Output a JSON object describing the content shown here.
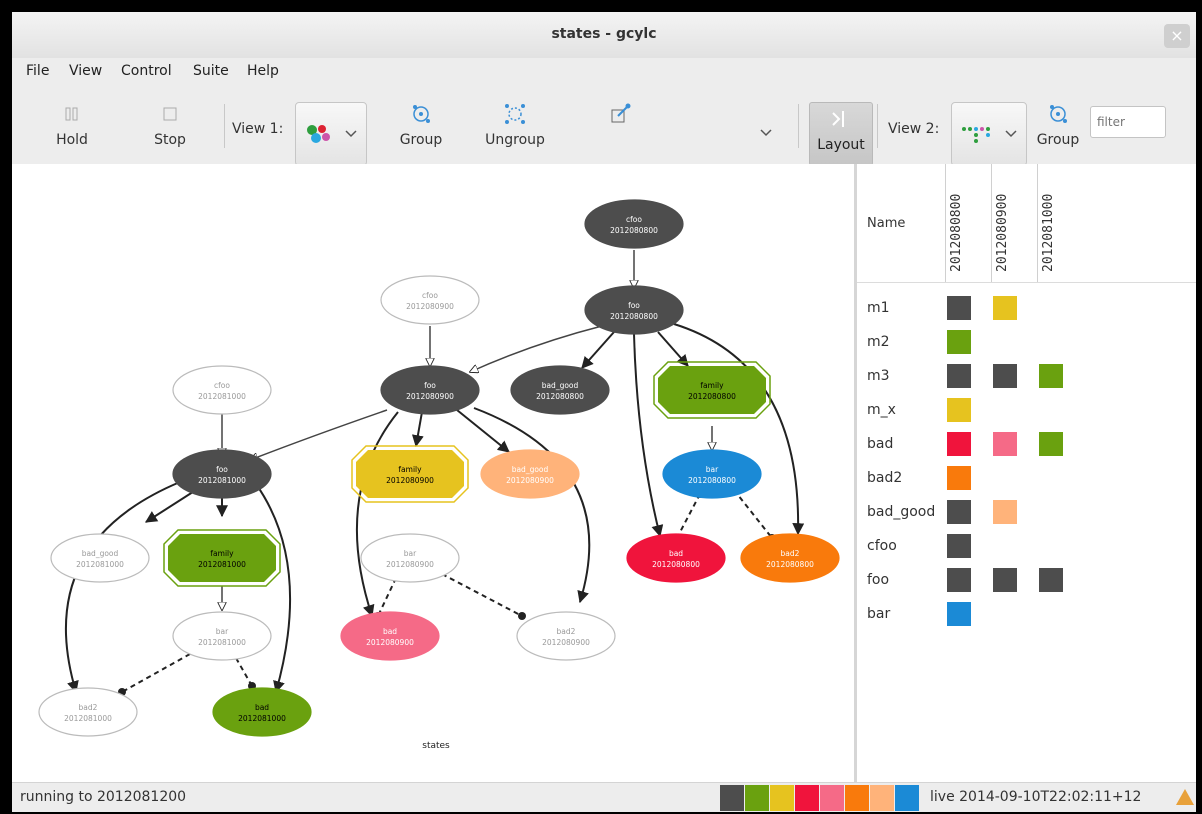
{
  "window": {
    "title": "states - gcylc"
  },
  "menu": [
    "File",
    "View",
    "Control",
    "Suite",
    "Help"
  ],
  "toolbar": {
    "hold": "Hold",
    "stop": "Stop",
    "view1": "View 1:",
    "group": "Group",
    "ungroup": "Ungroup",
    "layout": "Layout",
    "view2": "View 2:",
    "group2": "Group",
    "filter_placeholder": "filter"
  },
  "graph": {
    "caption": "states",
    "nodes": [
      {
        "name": "cfoo",
        "point": "2012080800",
        "shape": "ellipse",
        "fill": "#4d4d4d",
        "text": "#ffffff"
      },
      {
        "name": "foo",
        "point": "2012080800",
        "shape": "ellipse",
        "fill": "#4d4d4d",
        "text": "#ffffff"
      },
      {
        "name": "cfoo",
        "point": "2012080900",
        "shape": "ellipse",
        "fill": "#ffffff",
        "text": "#999999"
      },
      {
        "name": "foo",
        "point": "2012080900",
        "shape": "ellipse",
        "fill": "#4d4d4d",
        "text": "#ffffff"
      },
      {
        "name": "bad_good",
        "point": "2012080800",
        "shape": "ellipse",
        "fill": "#4d4d4d",
        "text": "#ffffff"
      },
      {
        "name": "family",
        "point": "2012080800",
        "shape": "octagon",
        "fill": "#6aa10f",
        "text": "#000000"
      },
      {
        "name": "cfoo",
        "point": "2012081000",
        "shape": "ellipse",
        "fill": "#ffffff",
        "text": "#999999"
      },
      {
        "name": "foo",
        "point": "2012081000",
        "shape": "ellipse",
        "fill": "#4d4d4d",
        "text": "#ffffff"
      },
      {
        "name": "family",
        "point": "2012080900",
        "shape": "octagon",
        "fill": "#e6c31f",
        "text": "#000000"
      },
      {
        "name": "bad_good",
        "point": "2012080900",
        "shape": "ellipse",
        "fill": "#ffb37a",
        "text": "#ffffff"
      },
      {
        "name": "bar",
        "point": "2012080800",
        "shape": "ellipse",
        "fill": "#1b8ad6",
        "text": "#ffffff"
      },
      {
        "name": "bad_good",
        "point": "2012081000",
        "shape": "ellipse",
        "fill": "#ffffff",
        "text": "#999999"
      },
      {
        "name": "family",
        "point": "2012081000",
        "shape": "octagon",
        "fill": "#6aa10f",
        "text": "#000000"
      },
      {
        "name": "bar",
        "point": "2012080900",
        "shape": "ellipse",
        "fill": "#ffffff",
        "text": "#999999"
      },
      {
        "name": "bad",
        "point": "2012080800",
        "shape": "ellipse",
        "fill": "#f0143c",
        "text": "#ffffff"
      },
      {
        "name": "bad2",
        "point": "2012080800",
        "shape": "ellipse",
        "fill": "#f97a0c",
        "text": "#ffffff"
      },
      {
        "name": "bar",
        "point": "2012081000",
        "shape": "ellipse",
        "fill": "#ffffff",
        "text": "#999999"
      },
      {
        "name": "bad",
        "point": "2012080900",
        "shape": "ellipse",
        "fill": "#f56a87",
        "text": "#ffffff"
      },
      {
        "name": "bad2",
        "point": "2012080900",
        "shape": "ellipse",
        "fill": "#ffffff",
        "text": "#999999"
      },
      {
        "name": "bad2",
        "point": "2012081000",
        "shape": "ellipse",
        "fill": "#ffffff",
        "text": "#999999"
      },
      {
        "name": "bad",
        "point": "2012081000",
        "shape": "ellipse",
        "fill": "#6aa10f",
        "text": "#000000"
      }
    ]
  },
  "grid": {
    "name_header": "Name",
    "columns": [
      "2012080800",
      "2012080900",
      "2012081000"
    ],
    "rows": [
      {
        "name": "m1",
        "cells": [
          "#4d4d4d",
          "#e6c31f",
          ""
        ]
      },
      {
        "name": "m2",
        "cells": [
          "#6aa10f",
          "",
          ""
        ]
      },
      {
        "name": "m3",
        "cells": [
          "#4d4d4d",
          "#4d4d4d",
          "#6aa10f"
        ]
      },
      {
        "name": "m_x",
        "cells": [
          "#e6c31f",
          "",
          ""
        ]
      },
      {
        "name": "bad",
        "cells": [
          "#f0143c",
          "#f56a87",
          "#6aa10f"
        ]
      },
      {
        "name": "bad2",
        "cells": [
          "#f97a0c",
          "",
          ""
        ]
      },
      {
        "name": "bad_good",
        "cells": [
          "#4d4d4d",
          "#ffb37a",
          ""
        ]
      },
      {
        "name": "cfoo",
        "cells": [
          "#4d4d4d",
          "",
          ""
        ]
      },
      {
        "name": "foo",
        "cells": [
          "#4d4d4d",
          "#4d4d4d",
          "#4d4d4d"
        ]
      },
      {
        "name": "bar",
        "cells": [
          "#1b8ad6",
          "",
          ""
        ]
      }
    ]
  },
  "statusbar": {
    "status": "running to 2012081200",
    "legend_colors": [
      "#4d4d4d",
      "#6aa10f",
      "#e6c31f",
      "#f0143c",
      "#f56a87",
      "#f97a0c",
      "#ffb37a",
      "#1b8ad6"
    ],
    "live": "live  2014-09-10T22:02:11+12"
  }
}
